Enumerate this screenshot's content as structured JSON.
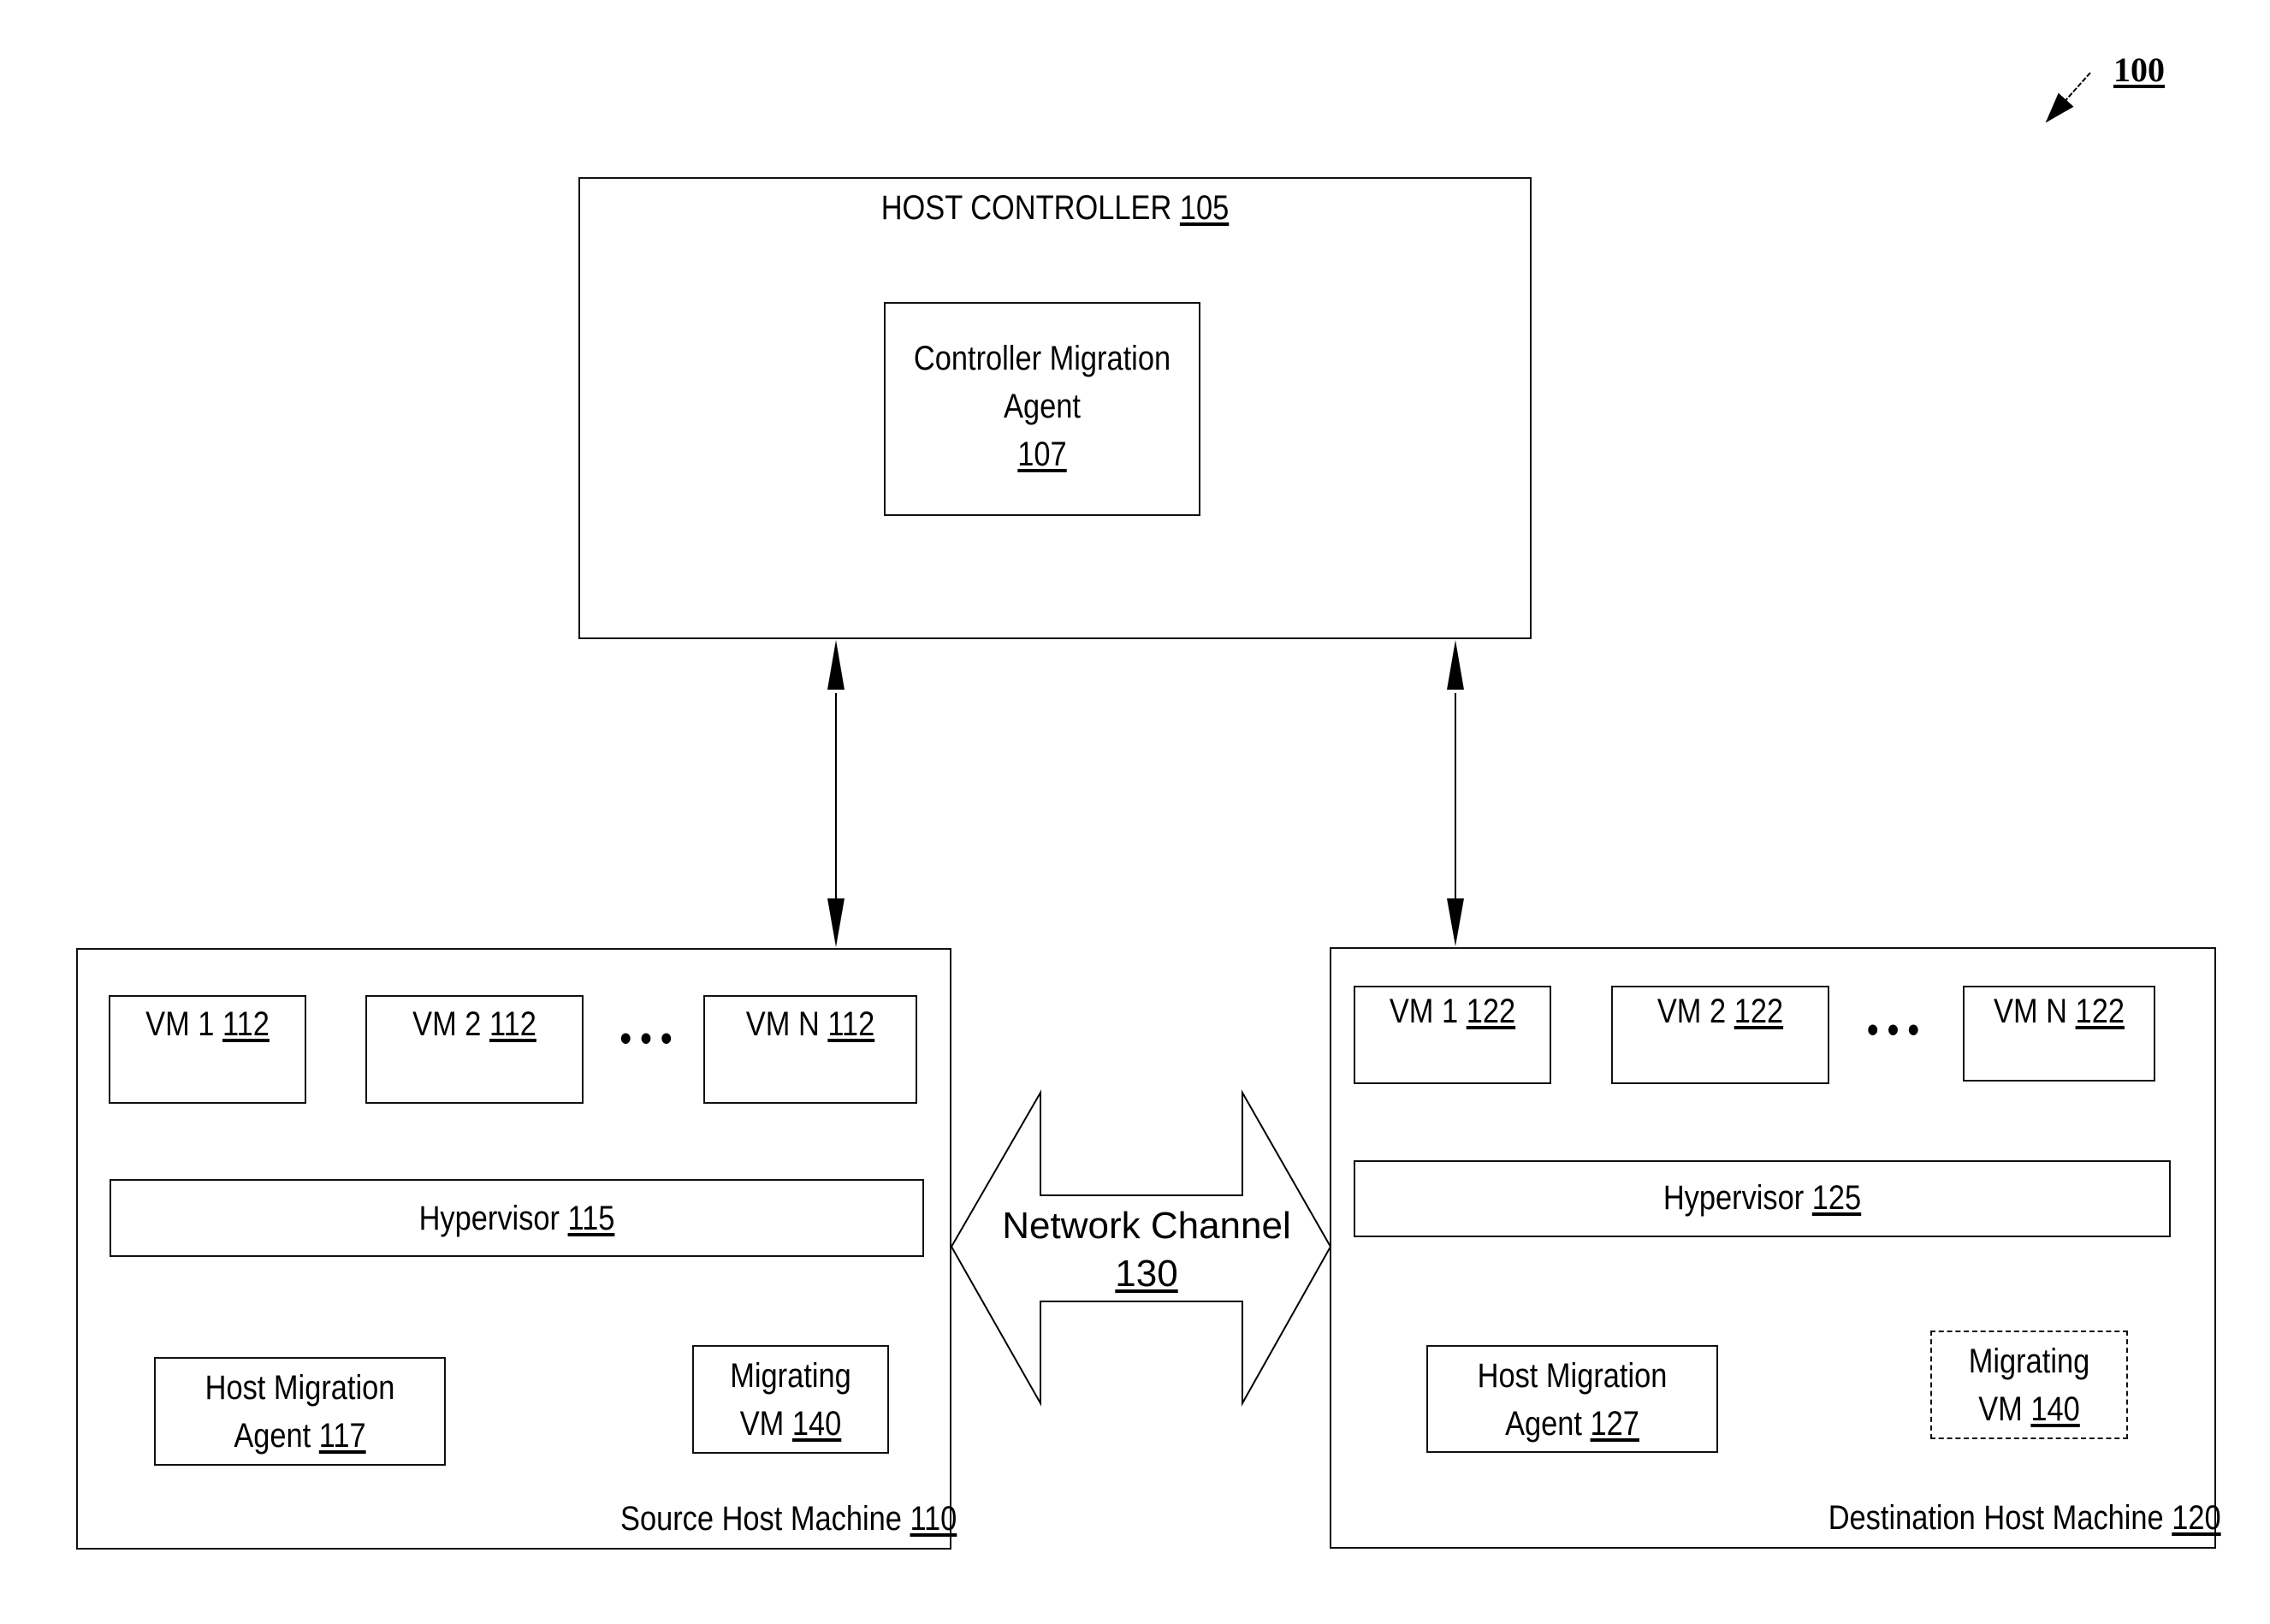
{
  "figure": {
    "ref": "100"
  },
  "host_controller": {
    "title": "HOST CONTROLLER",
    "ref": "105",
    "agent": {
      "line1": "Controller Migration",
      "line2": "Agent",
      "ref": "107"
    }
  },
  "source_host": {
    "label": "Source Host Machine",
    "ref": "110",
    "vms": [
      {
        "name": "VM 1",
        "ref": "112"
      },
      {
        "name": "VM 2",
        "ref": "112"
      },
      {
        "name": "VM N",
        "ref": "112"
      }
    ],
    "ellipsis": "• • •",
    "hypervisor": {
      "name": "Hypervisor",
      "ref": "115"
    },
    "agent": {
      "line1": "Host Migration",
      "line2": "Agent",
      "ref": "117"
    },
    "migrating_vm": {
      "line1": "Migrating",
      "line2": "VM",
      "ref": "140"
    }
  },
  "network": {
    "label": "Network Channel",
    "ref": "130"
  },
  "destination_host": {
    "label": "Destination Host Machine",
    "ref": "120",
    "vms": [
      {
        "name": "VM 1",
        "ref": "122"
      },
      {
        "name": "VM 2",
        "ref": "122"
      },
      {
        "name": "VM N",
        "ref": "122"
      }
    ],
    "ellipsis": "• • •",
    "hypervisor": {
      "name": "Hypervisor",
      "ref": "125"
    },
    "agent": {
      "line1": "Host Migration",
      "line2": "Agent",
      "ref": "127"
    },
    "migrating_vm": {
      "line1": "Migrating",
      "line2": "VM",
      "ref": "140"
    }
  }
}
